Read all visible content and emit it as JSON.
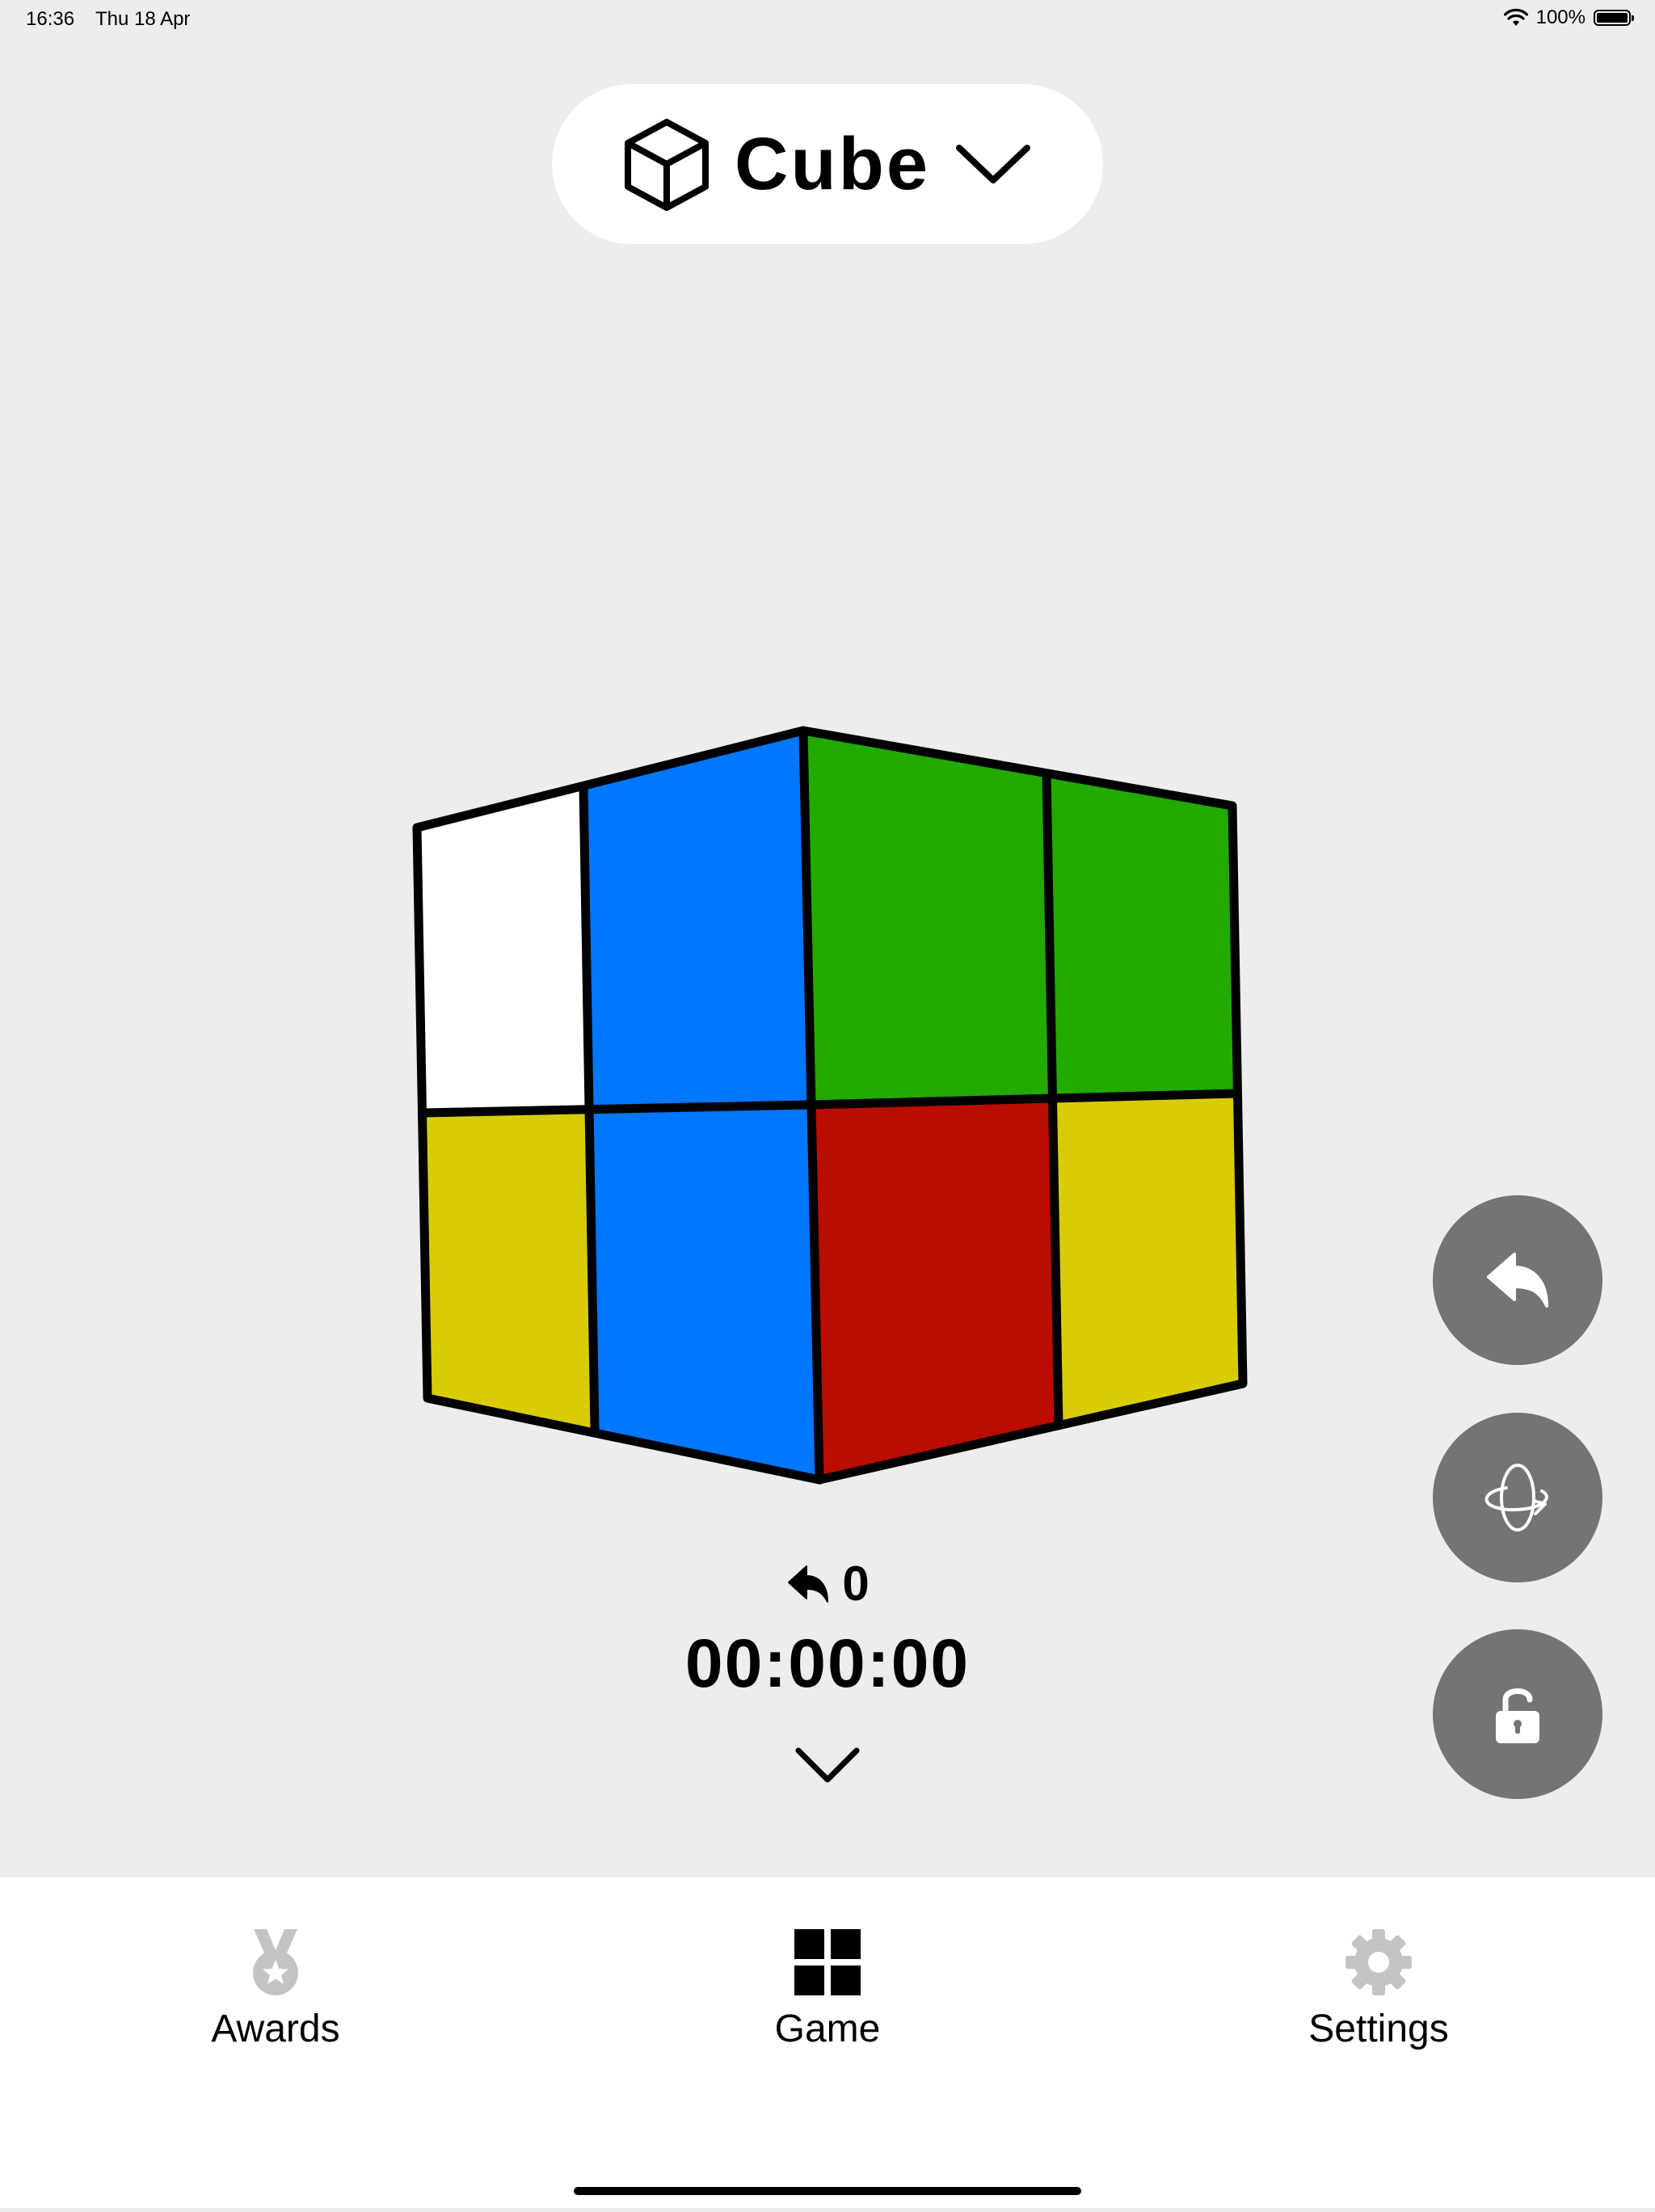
{
  "status_bar": {
    "time": "16:36",
    "date": "Thu 18 Apr",
    "battery": "100%"
  },
  "header": {
    "title": "Cube",
    "icon": "cube-icon",
    "chevron": "chevron-down-icon"
  },
  "cube": {
    "colors": {
      "white": "#ffffff",
      "blue": "#0077ff",
      "green": "#22aa00",
      "red": "#bb0c00",
      "yellow": "#d8cd05"
    },
    "left_face": [
      "white",
      "blue",
      "yellow",
      "blue"
    ],
    "right_face": [
      "green",
      "green",
      "red",
      "yellow"
    ]
  },
  "stats": {
    "moves": "0",
    "timer": "00:00:00"
  },
  "side_buttons": [
    {
      "name": "undo-button",
      "icon": "undo-arrow-icon"
    },
    {
      "name": "rotate-button",
      "icon": "rotate-icon"
    },
    {
      "name": "lock-button",
      "icon": "unlock-icon"
    }
  ],
  "tabs": [
    {
      "label": "Awards",
      "icon": "medal-icon",
      "active": false
    },
    {
      "label": "Game",
      "icon": "grid-icon",
      "active": true
    },
    {
      "label": "Settings",
      "icon": "gear-icon",
      "active": false
    }
  ]
}
